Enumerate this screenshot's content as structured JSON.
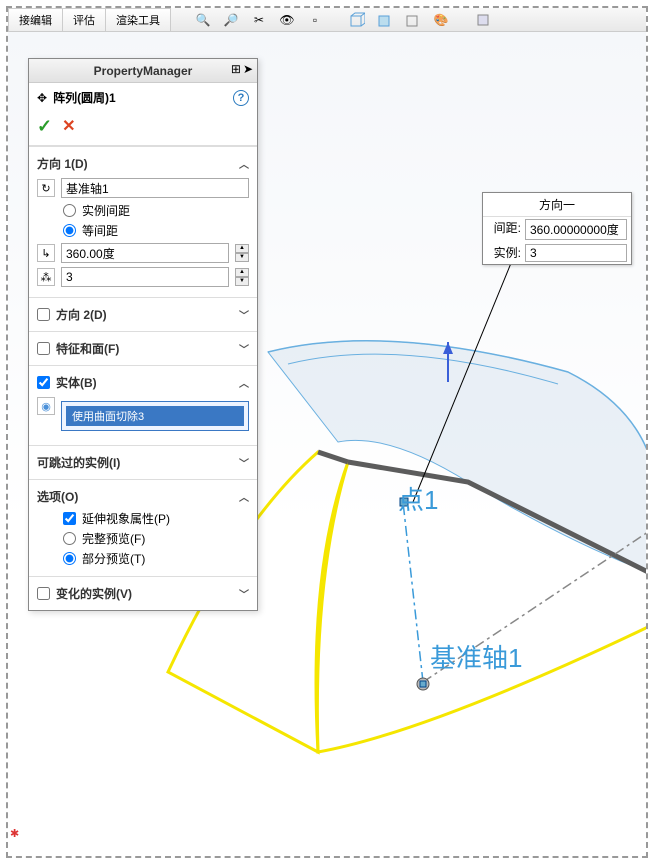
{
  "tabs": {
    "t1": "接编辑",
    "t2": "评估",
    "t3": "渲染工具"
  },
  "pm": {
    "title": "PropertyManager",
    "feature": "阵列(圆周)1",
    "dir1": {
      "title": "方向 1(D)",
      "axis": "基准轴1",
      "radio_inst": "实例间距",
      "radio_equal": "等间距",
      "angle": "360.00度",
      "count": "3"
    },
    "dir2": "方向 2(D)",
    "feat_face": "特征和面(F)",
    "body": {
      "title": "实体(B)",
      "item": "使用曲面切除3"
    },
    "skip": "可跳过的实例(I)",
    "opts": {
      "title": "选项(O)",
      "extend": "延伸视象属性(P)",
      "full": "完整预览(F)",
      "partial": "部分预览(T)"
    },
    "varied": "变化的实例(V)"
  },
  "callout": {
    "title": "方向一",
    "spacing_lbl": "间距:",
    "spacing_val": "360.00000000度",
    "inst_lbl": "实例:",
    "inst_val": "3"
  },
  "labels3d": {
    "point": "点1",
    "axis": "基准轴1"
  }
}
